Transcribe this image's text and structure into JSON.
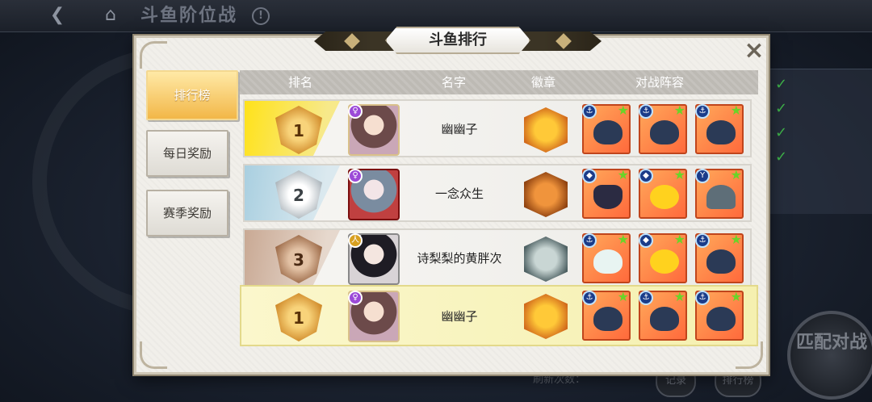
{
  "background": {
    "screen_title": "斗鱼阶位战",
    "info_icon": "!",
    "match_button": "匹配对战",
    "bottom_note": "刷新次数：",
    "bottom_buttons": [
      "记录",
      "排行榜"
    ]
  },
  "modal": {
    "title": "斗鱼排行",
    "close_icon": "×",
    "tabs": [
      {
        "label": "排行榜",
        "active": true
      },
      {
        "label": "每日奖励",
        "active": false
      },
      {
        "label": "赛季奖励",
        "active": false
      }
    ],
    "columns": {
      "rank": "排名",
      "name": "名字",
      "badge": "徽章",
      "lineup": "对战阵容"
    },
    "rows": [
      {
        "rank": "1",
        "tier": "gold",
        "name": "幽幽子",
        "avatar_level": "♀",
        "badge_icon": "golden-fish-emblem",
        "lineup": [
          {
            "cls": "⚓",
            "type": "shark-fish"
          },
          {
            "cls": "⚓",
            "type": "shark-fish"
          },
          {
            "cls": "⚓",
            "type": "shark-fish"
          }
        ]
      },
      {
        "rank": "2",
        "tier": "silver",
        "name": "一念众生",
        "avatar_level": "♀",
        "badge_icon": "bronze-fish-emblem",
        "lineup": [
          {
            "cls": "◆",
            "type": "witch-fish"
          },
          {
            "cls": "◆",
            "type": "yellow-fish"
          },
          {
            "cls": "Y",
            "type": "whale-fish"
          }
        ]
      },
      {
        "rank": "3",
        "tier": "bronze",
        "name": "诗梨梨的黄胖次",
        "avatar_level": "人",
        "badge_icon": "silver-fish-emblem",
        "lineup": [
          {
            "cls": "⚓",
            "type": "seahorse-fish"
          },
          {
            "cls": "◆",
            "type": "yellow-fish"
          },
          {
            "cls": "⚓",
            "type": "shark-fish"
          }
        ]
      }
    ],
    "my_row": {
      "rank": "1",
      "tier": "gold",
      "name": "幽幽子",
      "avatar_level": "♀",
      "badge_icon": "golden-fish-emblem",
      "lineup": [
        {
          "cls": "⚓",
          "type": "shark-fish"
        },
        {
          "cls": "⚓",
          "type": "shark-fish"
        },
        {
          "cls": "⚓",
          "type": "shark-fish"
        }
      ]
    }
  }
}
